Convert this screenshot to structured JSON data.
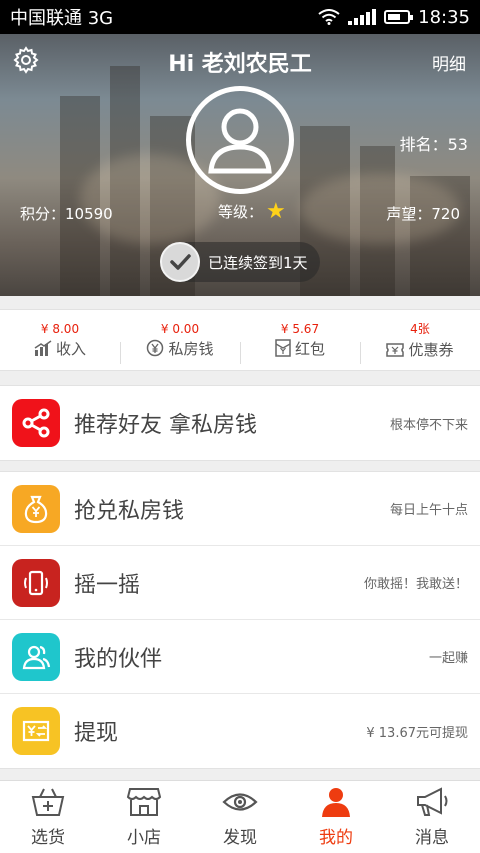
{
  "status_bar": {
    "carrier": "中国联通 3G",
    "time": "18:35"
  },
  "header": {
    "title": "Hi 老刘农民工",
    "detail_label": "明细",
    "rank": "排名：53",
    "points": "积分：10590",
    "level_label": "等级：",
    "fame": "声望：720",
    "checkin_label": "已连续签到1天"
  },
  "stats": [
    {
      "value": "¥ 8.00",
      "label": "收入",
      "icon": "chart-icon"
    },
    {
      "value": "¥ 0.00",
      "label": "私房钱",
      "icon": "yen-circle-icon"
    },
    {
      "value": "¥ 5.67",
      "label": "红包",
      "icon": "red-packet-icon"
    },
    {
      "value": "4张",
      "label": "优惠券",
      "icon": "coupon-icon"
    }
  ],
  "invite": {
    "label": "推荐好友 拿私房钱",
    "note": "根本停不下来",
    "icon": "share-icon",
    "color": "#f0121a"
  },
  "menu": [
    {
      "label": "抢兑私房钱",
      "note": "每日上午十点",
      "icon": "money-bag-icon",
      "color": "#f7a824"
    },
    {
      "label": "摇一摇",
      "note": "你敢摇！我敢送！",
      "icon": "shake-phone-icon",
      "color": "#c8231f"
    },
    {
      "label": "我的伙伴",
      "note": "一起赚",
      "icon": "partner-icon",
      "color": "#1fc6cc"
    },
    {
      "label": "提现",
      "note": "¥ 13.67元可提现",
      "icon": "withdraw-icon",
      "color": "#f7c324"
    }
  ],
  "tabs": [
    {
      "label": "选货",
      "icon": "basket-icon"
    },
    {
      "label": "小店",
      "icon": "shop-icon"
    },
    {
      "label": "发现",
      "icon": "eye-icon"
    },
    {
      "label": "我的",
      "icon": "person-icon",
      "active": true
    },
    {
      "label": "消息",
      "icon": "megaphone-icon"
    }
  ],
  "colors": {
    "accent": "#ee3c10",
    "price_red": "#e8210d"
  }
}
